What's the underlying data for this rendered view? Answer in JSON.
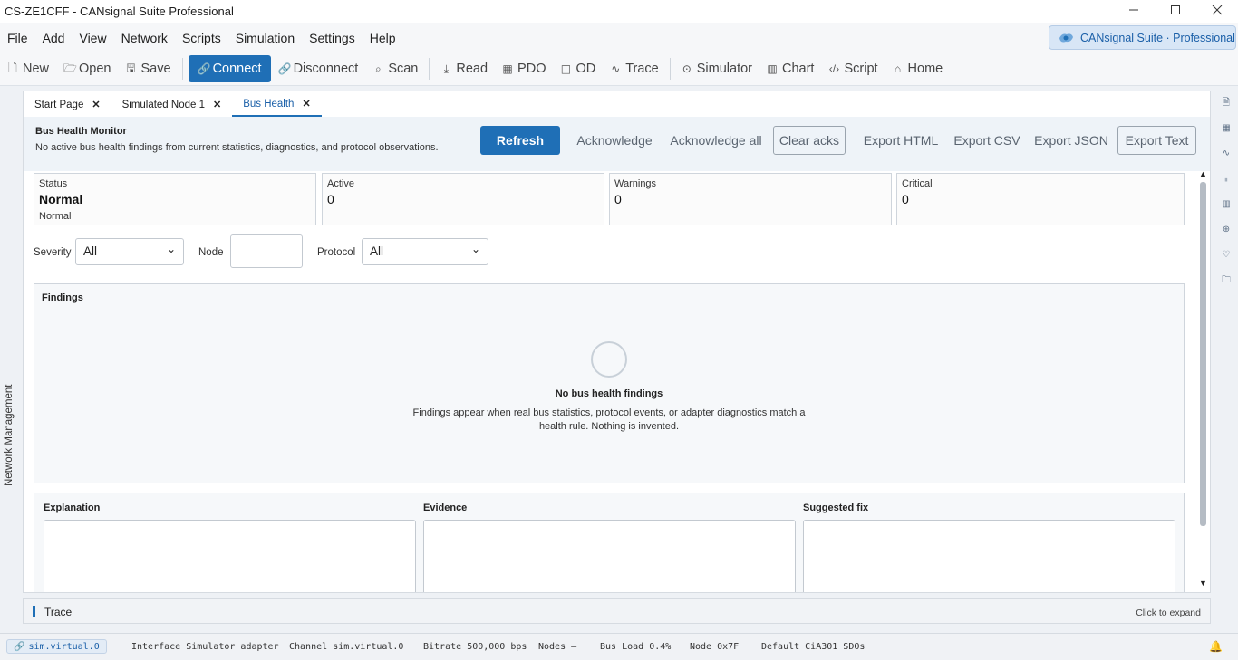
{
  "window": {
    "title": "CS-ZE1CFF - CANsignal Suite Professional"
  },
  "menu": [
    "File",
    "Add",
    "View",
    "Network",
    "Scripts",
    "Simulation",
    "Settings",
    "Help"
  ],
  "brand": {
    "label": "CANsignal Suite · Professional"
  },
  "toolbar": {
    "new": "New",
    "open": "Open",
    "save": "Save",
    "connect": "Connect",
    "disconnect": "Disconnect",
    "scan": "Scan",
    "read": "Read",
    "pdo": "PDO",
    "od": "OD",
    "trace": "Trace",
    "simulator": "Simulator",
    "chart": "Chart",
    "script": "Script",
    "home": "Home"
  },
  "left_panel": {
    "label": "Network Management"
  },
  "tabs": [
    {
      "label": "Start Page"
    },
    {
      "label": "Simulated Node 1"
    },
    {
      "label": "Bus Health"
    }
  ],
  "header": {
    "title": "Bus Health Monitor",
    "subtitle": "No active bus health findings from current statistics, diagnostics, and protocol observations.",
    "refresh": "Refresh",
    "acknowledge": "Acknowledge",
    "acknowledge_all": "Acknowledge all",
    "clear_acks": "Clear acks",
    "export_html": "Export HTML",
    "export_csv": "Export CSV",
    "export_json": "Export JSON",
    "export_text": "Export Text"
  },
  "cards": {
    "status": {
      "label": "Status",
      "value": "Normal",
      "sub": "Normal"
    },
    "active": {
      "label": "Active",
      "value": "0"
    },
    "warnings": {
      "label": "Warnings",
      "value": "0"
    },
    "critical": {
      "label": "Critical",
      "value": "0"
    }
  },
  "filters": {
    "severity_label": "Severity",
    "severity_value": "All",
    "node_label": "Node",
    "node_value": "",
    "protocol_label": "Protocol",
    "protocol_value": "All"
  },
  "findings": {
    "title": "Findings",
    "empty_title": "No bus health findings",
    "empty_text": "Findings appear when real bus statistics, protocol events, or adapter diagnostics match a health rule. Nothing is invented."
  },
  "details": {
    "explanation": "Explanation",
    "evidence": "Evidence",
    "suggested_fix": "Suggested fix"
  },
  "trace_panel": {
    "label": "Trace",
    "hint": "Click to expand"
  },
  "status_bar": {
    "adapter": "sim.virtual.0",
    "interface_label": "Interface",
    "interface_value": "Simulator adapter",
    "channel_label": "Channel",
    "channel_value": "sim.virtual.0",
    "bitrate_label": "Bitrate",
    "bitrate_value": "500,000 bps",
    "nodes_label": "Nodes",
    "nodes_value": "–",
    "busload_label": "Bus Load",
    "busload_value": "0.4%",
    "node_label": "Node",
    "node_value": "0x7F",
    "sdo_profile": "Default CiA301 SDOs"
  },
  "colors": {
    "accent": "#1f6fb6",
    "header_bg": "#eef3f8"
  }
}
